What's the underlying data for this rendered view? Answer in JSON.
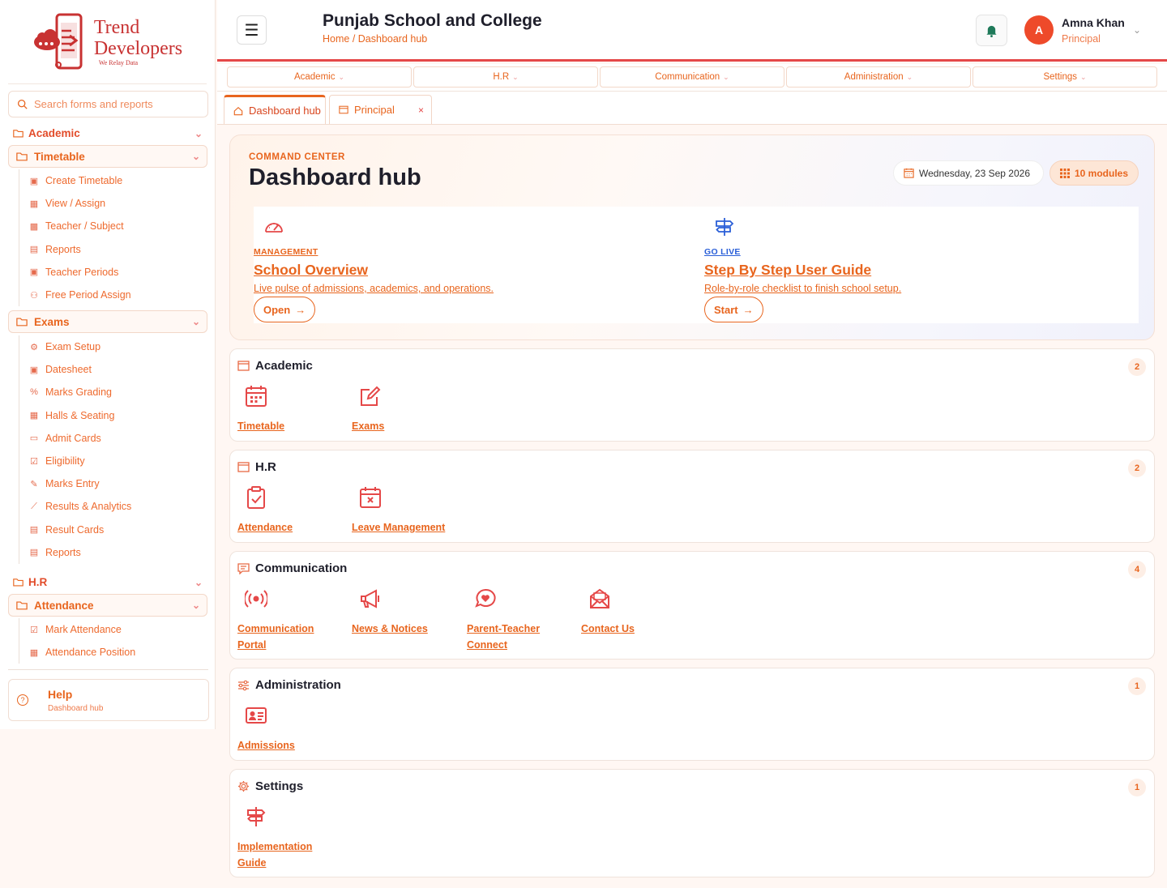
{
  "brand": {
    "line1": "Trend",
    "line2": "Developers",
    "tagline": "We Relay Data"
  },
  "sidebar": {
    "search_placeholder": "Search forms and reports",
    "sections": [
      {
        "label": "Academic",
        "groups": [
          {
            "label": "Timetable",
            "items": [
              "Create Timetable",
              "View / Assign",
              "Teacher / Subject",
              "Reports",
              "Teacher Periods",
              "Free Period Assign"
            ]
          },
          {
            "label": "Exams",
            "items": [
              "Exam Setup",
              "Datesheet",
              "Marks Grading",
              "Halls & Seating",
              "Admit Cards",
              "Eligibility",
              "Marks Entry",
              "Results & Analytics",
              "Result Cards",
              "Reports"
            ]
          }
        ]
      },
      {
        "label": "H.R",
        "groups": [
          {
            "label": "Attendance",
            "items": [
              "Mark Attendance",
              "Attendance Position"
            ]
          }
        ]
      }
    ],
    "help": {
      "title": "Help",
      "subtitle": "Dashboard hub"
    }
  },
  "header": {
    "school_name": "Punjab School and College",
    "breadcrumb": "Home / Dashboard hub",
    "user": {
      "initial": "A",
      "name": "Amna Khan",
      "role": "Principal"
    }
  },
  "nav": [
    "Academic",
    "H.R",
    "Communication",
    "Administration",
    "Settings"
  ],
  "tabs": [
    {
      "label": "Dashboard hub",
      "active": true
    },
    {
      "label": "Principal",
      "active": false,
      "close": "×"
    }
  ],
  "hero": {
    "eyebrow": "COMMAND CENTER",
    "title": "Dashboard hub",
    "date": "Wednesday, 23 Sep 2026",
    "modules": "10 modules",
    "cards": [
      {
        "tag": "MANAGEMENT",
        "title": "School Overview",
        "desc": "Live pulse of admissions, academics, and operations.",
        "button": "Open",
        "icon": "speedometer-icon",
        "tag_color": "#e8651e"
      },
      {
        "tag": "GO LIVE",
        "title": "Step By Step User Guide",
        "desc": "Role-by-role checklist to finish school setup.",
        "button": "Start",
        "icon": "signpost-icon",
        "tag_color": "#2a5fd8"
      }
    ]
  },
  "modules": [
    {
      "title": "Academic",
      "count": "2",
      "icon": "calendar-icon",
      "tiles": [
        {
          "label": "Timetable",
          "label2": "",
          "icon": "calendar-icon"
        },
        {
          "label": "Exams",
          "label2": "",
          "icon": "edit-icon"
        }
      ]
    },
    {
      "title": "H.R",
      "count": "2",
      "icon": "calendar-icon",
      "tiles": [
        {
          "label": "Attendance",
          "label2": "",
          "icon": "clipboard-check-icon"
        },
        {
          "label": "Leave Management",
          "label2": "",
          "icon": "calendar-x-icon"
        }
      ]
    },
    {
      "title": "Communication",
      "count": "4",
      "icon": "chat-icon",
      "tiles": [
        {
          "label": "Communication",
          "label2": "Portal",
          "icon": "broadcast-icon"
        },
        {
          "label": "News & Notices",
          "label2": "",
          "icon": "megaphone-icon"
        },
        {
          "label": "Parent-Teacher",
          "label2": "Connect",
          "icon": "chat-heart-icon"
        },
        {
          "label": "Contact Us",
          "label2": "",
          "icon": "envelope-icon"
        }
      ]
    },
    {
      "title": "Administration",
      "count": "1",
      "icon": "sliders-icon",
      "tiles": [
        {
          "label": "Admissions",
          "label2": "",
          "icon": "id-card-icon"
        }
      ]
    },
    {
      "title": "Settings",
      "count": "1",
      "icon": "gear-icon",
      "tiles": [
        {
          "label": "Implementation",
          "label2": "Guide",
          "icon": "signpost-icon"
        }
      ]
    }
  ],
  "colors": {
    "accent": "#e8651e",
    "brand_red": "#c83232",
    "header_line": "#e54848",
    "avatar": "#ee4a2a"
  }
}
